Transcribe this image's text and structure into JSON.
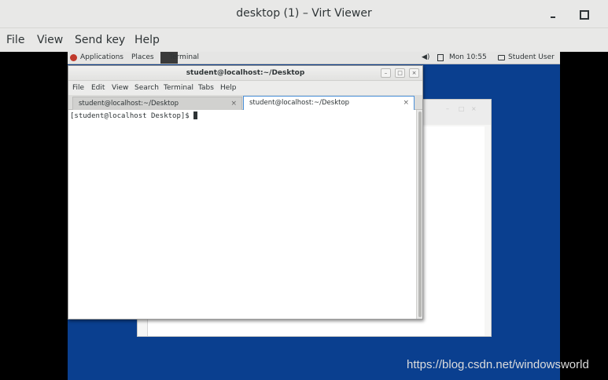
{
  "window": {
    "title": "desktop (1) – Virt Viewer"
  },
  "menubar": {
    "items": [
      "File",
      "View",
      "Send key",
      "Help"
    ]
  },
  "guest_topbar": {
    "applications": "Applications",
    "places": "Places",
    "task": "Terminal",
    "clock": "Mon 10:55",
    "user": "Student User"
  },
  "terminal": {
    "title": "student@localhost:~/Desktop",
    "menu": [
      "File",
      "Edit",
      "View",
      "Search",
      "Terminal",
      "Tabs",
      "Help"
    ],
    "tabs": [
      {
        "label": "student@localhost:~/Desktop",
        "active": false
      },
      {
        "label": "student@localhost:~/Desktop",
        "active": true
      }
    ],
    "prompt": "[student@localhost Desktop]$ "
  },
  "watermark": "https://blog.csdn.net/windowsworld",
  "icons": {
    "vv_minimize": "minimize-icon",
    "vv_maximize": "maximize-icon",
    "apps": "redhat-icon",
    "volume": "volume-icon",
    "network": "network-icon",
    "user": "user-icon",
    "tab_close": "close-icon"
  },
  "colors": {
    "desktop_bg": "#0a3f8f",
    "chrome_bg": "#e8e8e7",
    "active_tab_border": "#4a90d9"
  }
}
